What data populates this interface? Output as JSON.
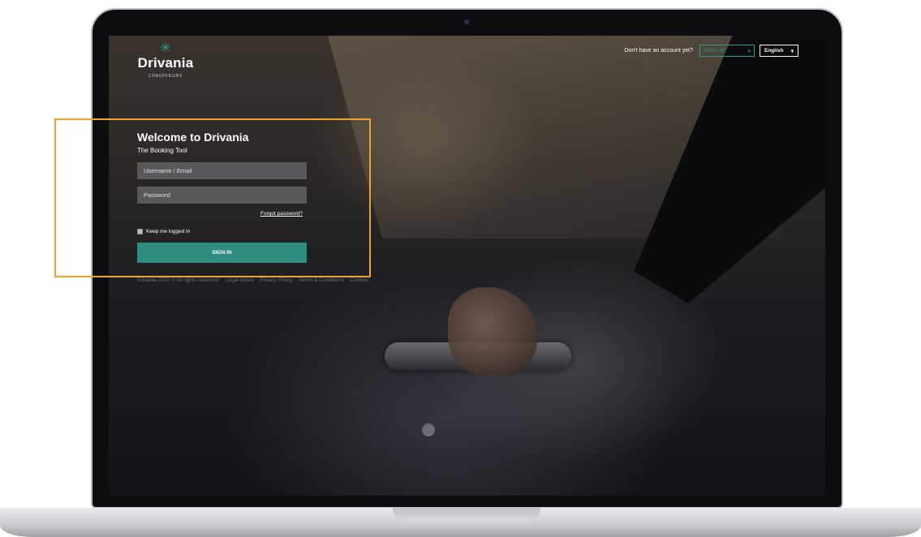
{
  "logo": {
    "wordmark": "Drivania",
    "tagline": "CHAUFFEURS"
  },
  "header": {
    "signup_prompt": "Don't have an account yet?",
    "signup_label": "SIGN UP",
    "language_label": "English"
  },
  "login": {
    "title": "Welcome to Drivania",
    "subtitle": "The Booking Tool",
    "username_placeholder": "Username / Email",
    "password_placeholder": "Password",
    "forgot_label": "Forgot password?",
    "keep_logged_label": "Keep me logged in",
    "signin_label": "SIGN IN"
  },
  "footer": {
    "items": [
      "Drivania 2022 © All rights reserved.",
      "Legal notice",
      "Privacy Policy",
      "Terms & Conditions",
      "Cookies"
    ]
  },
  "colors": {
    "accent": "#2e8d7f",
    "highlight": "#f2a131"
  },
  "icons": {
    "dropdown": "chevron-down-icon",
    "camera": "camera-icon"
  }
}
